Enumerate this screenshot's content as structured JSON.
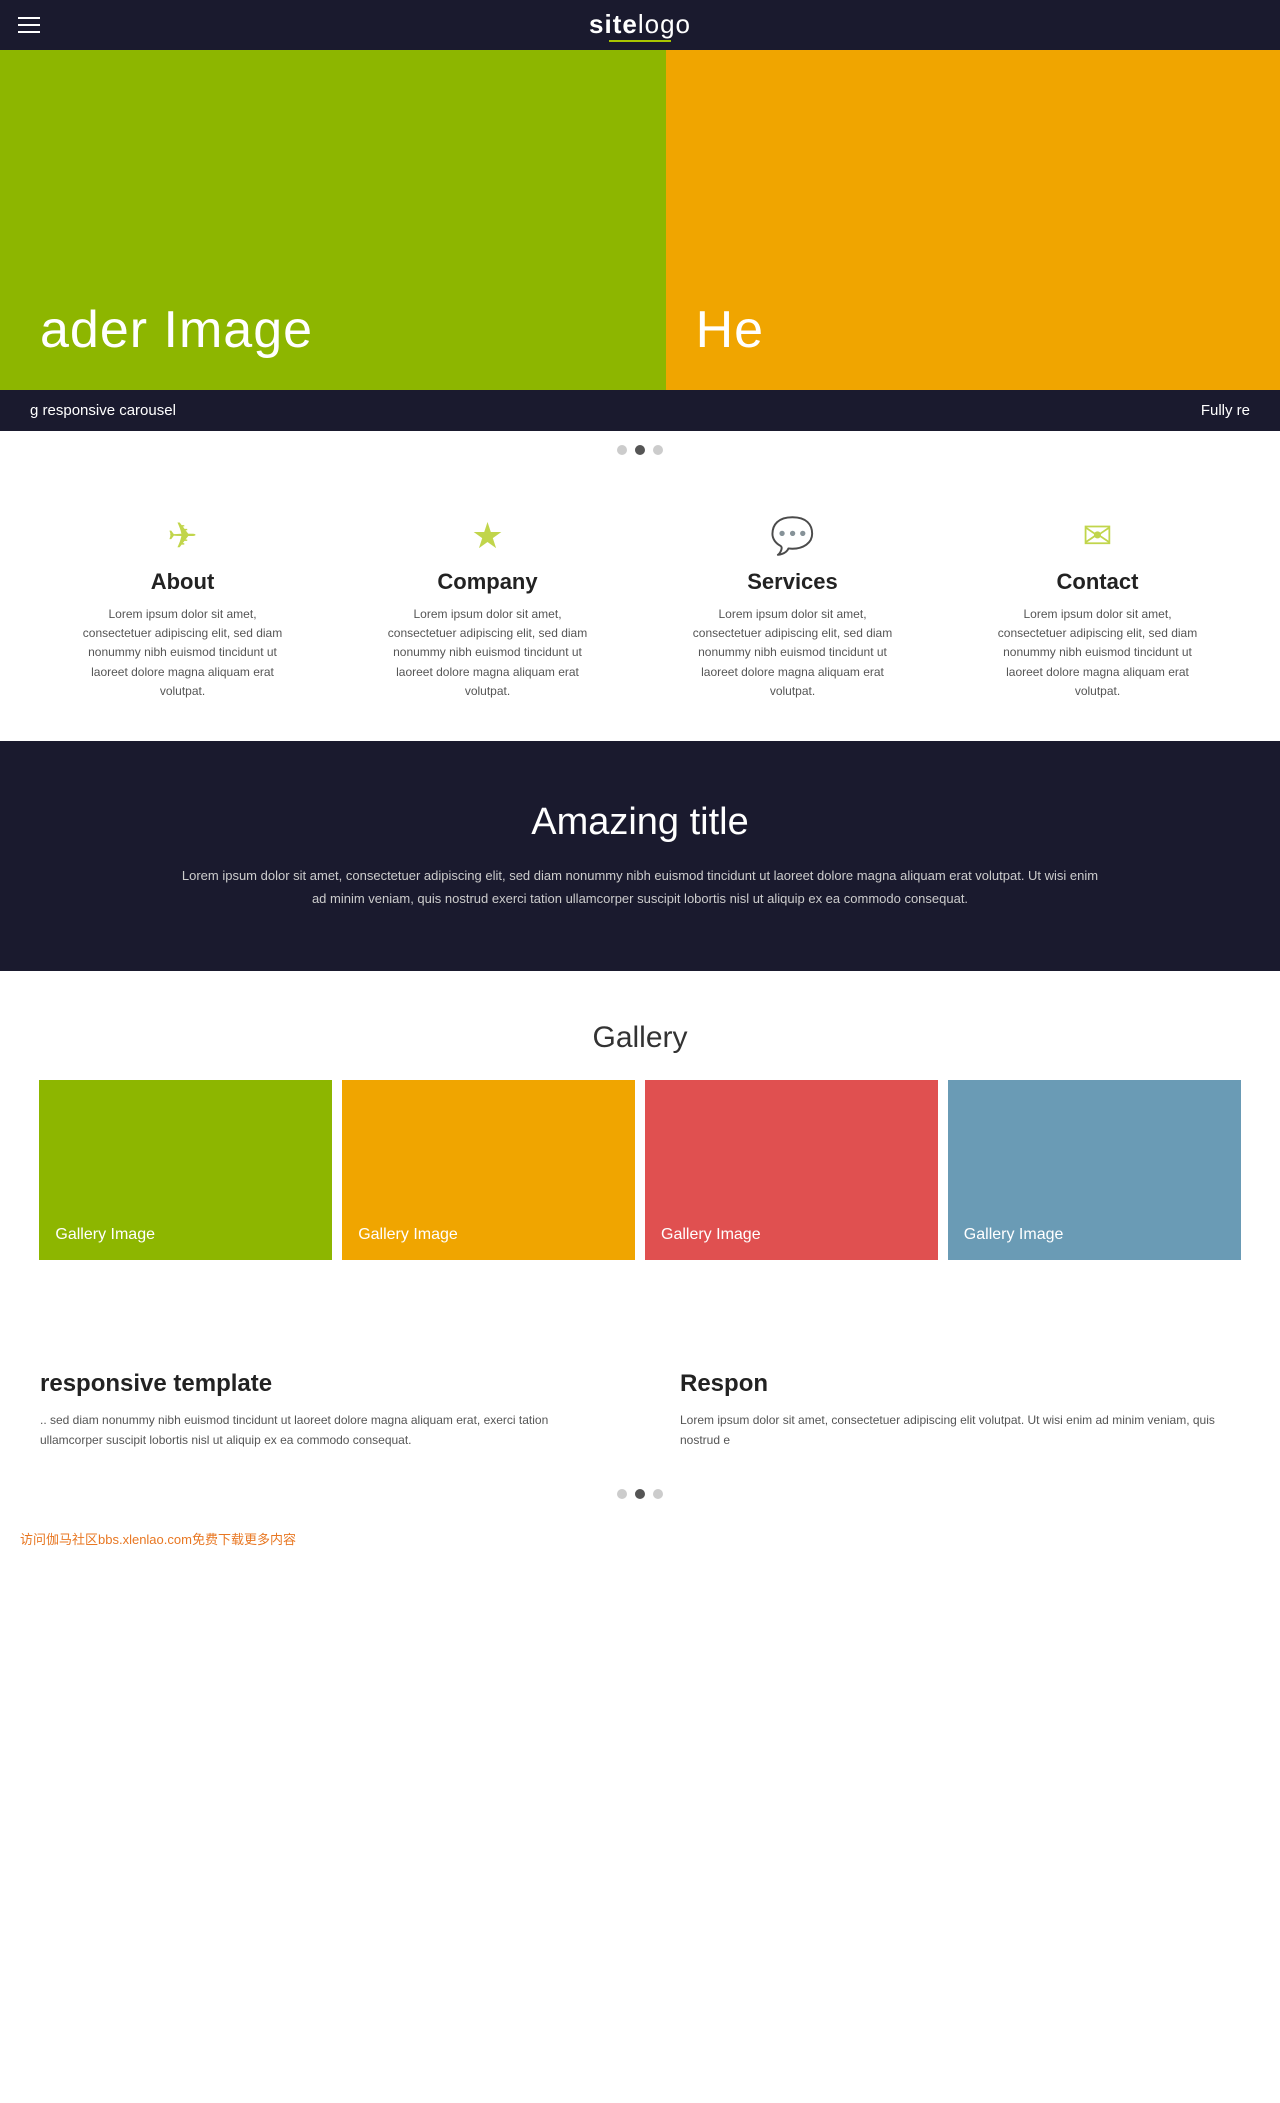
{
  "navbar": {
    "logo_site": "site",
    "logo_logo": "logo",
    "hamburger_label": "Menu"
  },
  "hero": {
    "left_text": "ader Image",
    "right_text": "He",
    "left_color": "#8db600",
    "right_color": "#f0a500",
    "caption_left": "g responsive carousel",
    "caption_right": "Fully re",
    "dots": [
      {
        "active": false
      },
      {
        "active": true
      },
      {
        "active": false
      }
    ]
  },
  "features": {
    "items": [
      {
        "icon": "✈",
        "title": "About",
        "desc": "Lorem ipsum dolor sit amet, consectetuer adipiscing elit, sed diam nonummy nibh euismod tincidunt ut laoreet dolore magna aliquam erat volutpat."
      },
      {
        "icon": "★",
        "title": "Company",
        "desc": "Lorem ipsum dolor sit amet, consectetuer adipiscing elit, sed diam nonummy nibh euismod tincidunt ut laoreet dolore magna aliquam erat volutpat."
      },
      {
        "icon": "💬",
        "title": "Services",
        "desc": "Lorem ipsum dolor sit amet, consectetuer adipiscing elit, sed diam nonummy nibh euismod tincidunt ut laoreet dolore magna aliquam erat volutpat."
      },
      {
        "icon": "✉",
        "title": "Contact",
        "desc": "Lorem ipsum dolor sit amet, consectetuer adipiscing elit, sed diam nonummy nibh euismod tincidunt ut laoreet dolore magna aliquam erat volutpat."
      }
    ]
  },
  "amazing": {
    "title": "Amazing title",
    "desc": "Lorem ipsum dolor sit amet, consectetuer adipiscing elit, sed diam nonummy nibh euismod tincidunt ut laoreet dolore magna aliquam erat volutpat. Ut wisi enim ad minim veniam, quis nostrud exerci tation ullamcorper suscipit lobortis nisl ut aliquip ex ea commodo consequat."
  },
  "gallery": {
    "title": "Gallery",
    "items": [
      {
        "label": "Gallery Image",
        "color_class": "gallery-green"
      },
      {
        "label": "Gallery Image",
        "color_class": "gallery-orange"
      },
      {
        "label": "Gallery Image",
        "color_class": "gallery-red"
      },
      {
        "label": "Gallery Image",
        "color_class": "gallery-blue"
      }
    ]
  },
  "responsive": {
    "col1_title": "responsive template",
    "col1_desc": ".. sed diam nonummy nibh euismod tincidunt ut laoreet dolore magna aliquam erat, exerci tation ullamcorper suscipit lobortis nisl ut aliquip ex ea commodo consequat.",
    "col2_title": "Respon",
    "col2_desc": "Lorem ipsum dolor sit amet, consectetuer adipiscing elit volutpat. Ut wisi enim ad minim veniam, quis nostrud e",
    "dots": [
      {
        "active": false
      },
      {
        "active": true
      },
      {
        "active": false
      }
    ]
  },
  "watermark": {
    "text": "访问伽马社区bbs.xlenlao.com免费下载更多内容"
  }
}
